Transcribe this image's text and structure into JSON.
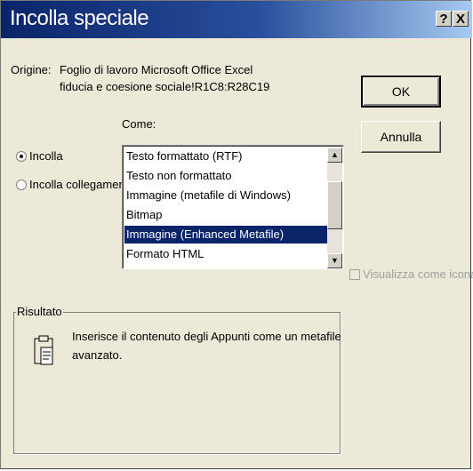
{
  "window": {
    "title": "Incolla speciale",
    "help_button": "?",
    "close_button": "X"
  },
  "source": {
    "label": "Origine:",
    "line1": "Foglio di lavoro Microsoft Office Excel",
    "line2": "fiducia e coesione sociale!R1C8:R28C19"
  },
  "as_label": "Come:",
  "options": {
    "paste": "Incolla",
    "paste_link": "Incolla collegamento",
    "selected": "paste"
  },
  "list": {
    "items": [
      "Testo formattato (RTF)",
      "Testo non formattato",
      "Immagine (metafile di Windows)",
      "Bitmap",
      "Immagine (Enhanced Metafile)",
      "Formato HTML"
    ],
    "selected_index": 4
  },
  "buttons": {
    "ok": "OK",
    "cancel": "Annulla"
  },
  "display_as_icon": {
    "label": "Visualizza come icona",
    "checked": false,
    "enabled": false
  },
  "result": {
    "label": "Risultato",
    "line1": "Inserisce il contenuto degli Appunti come un metafile",
    "line2": "avanzato."
  },
  "colors": {
    "title_bar": "#0a246a",
    "selection": "#0a246a",
    "dialog_bg": "#ece9d8"
  }
}
